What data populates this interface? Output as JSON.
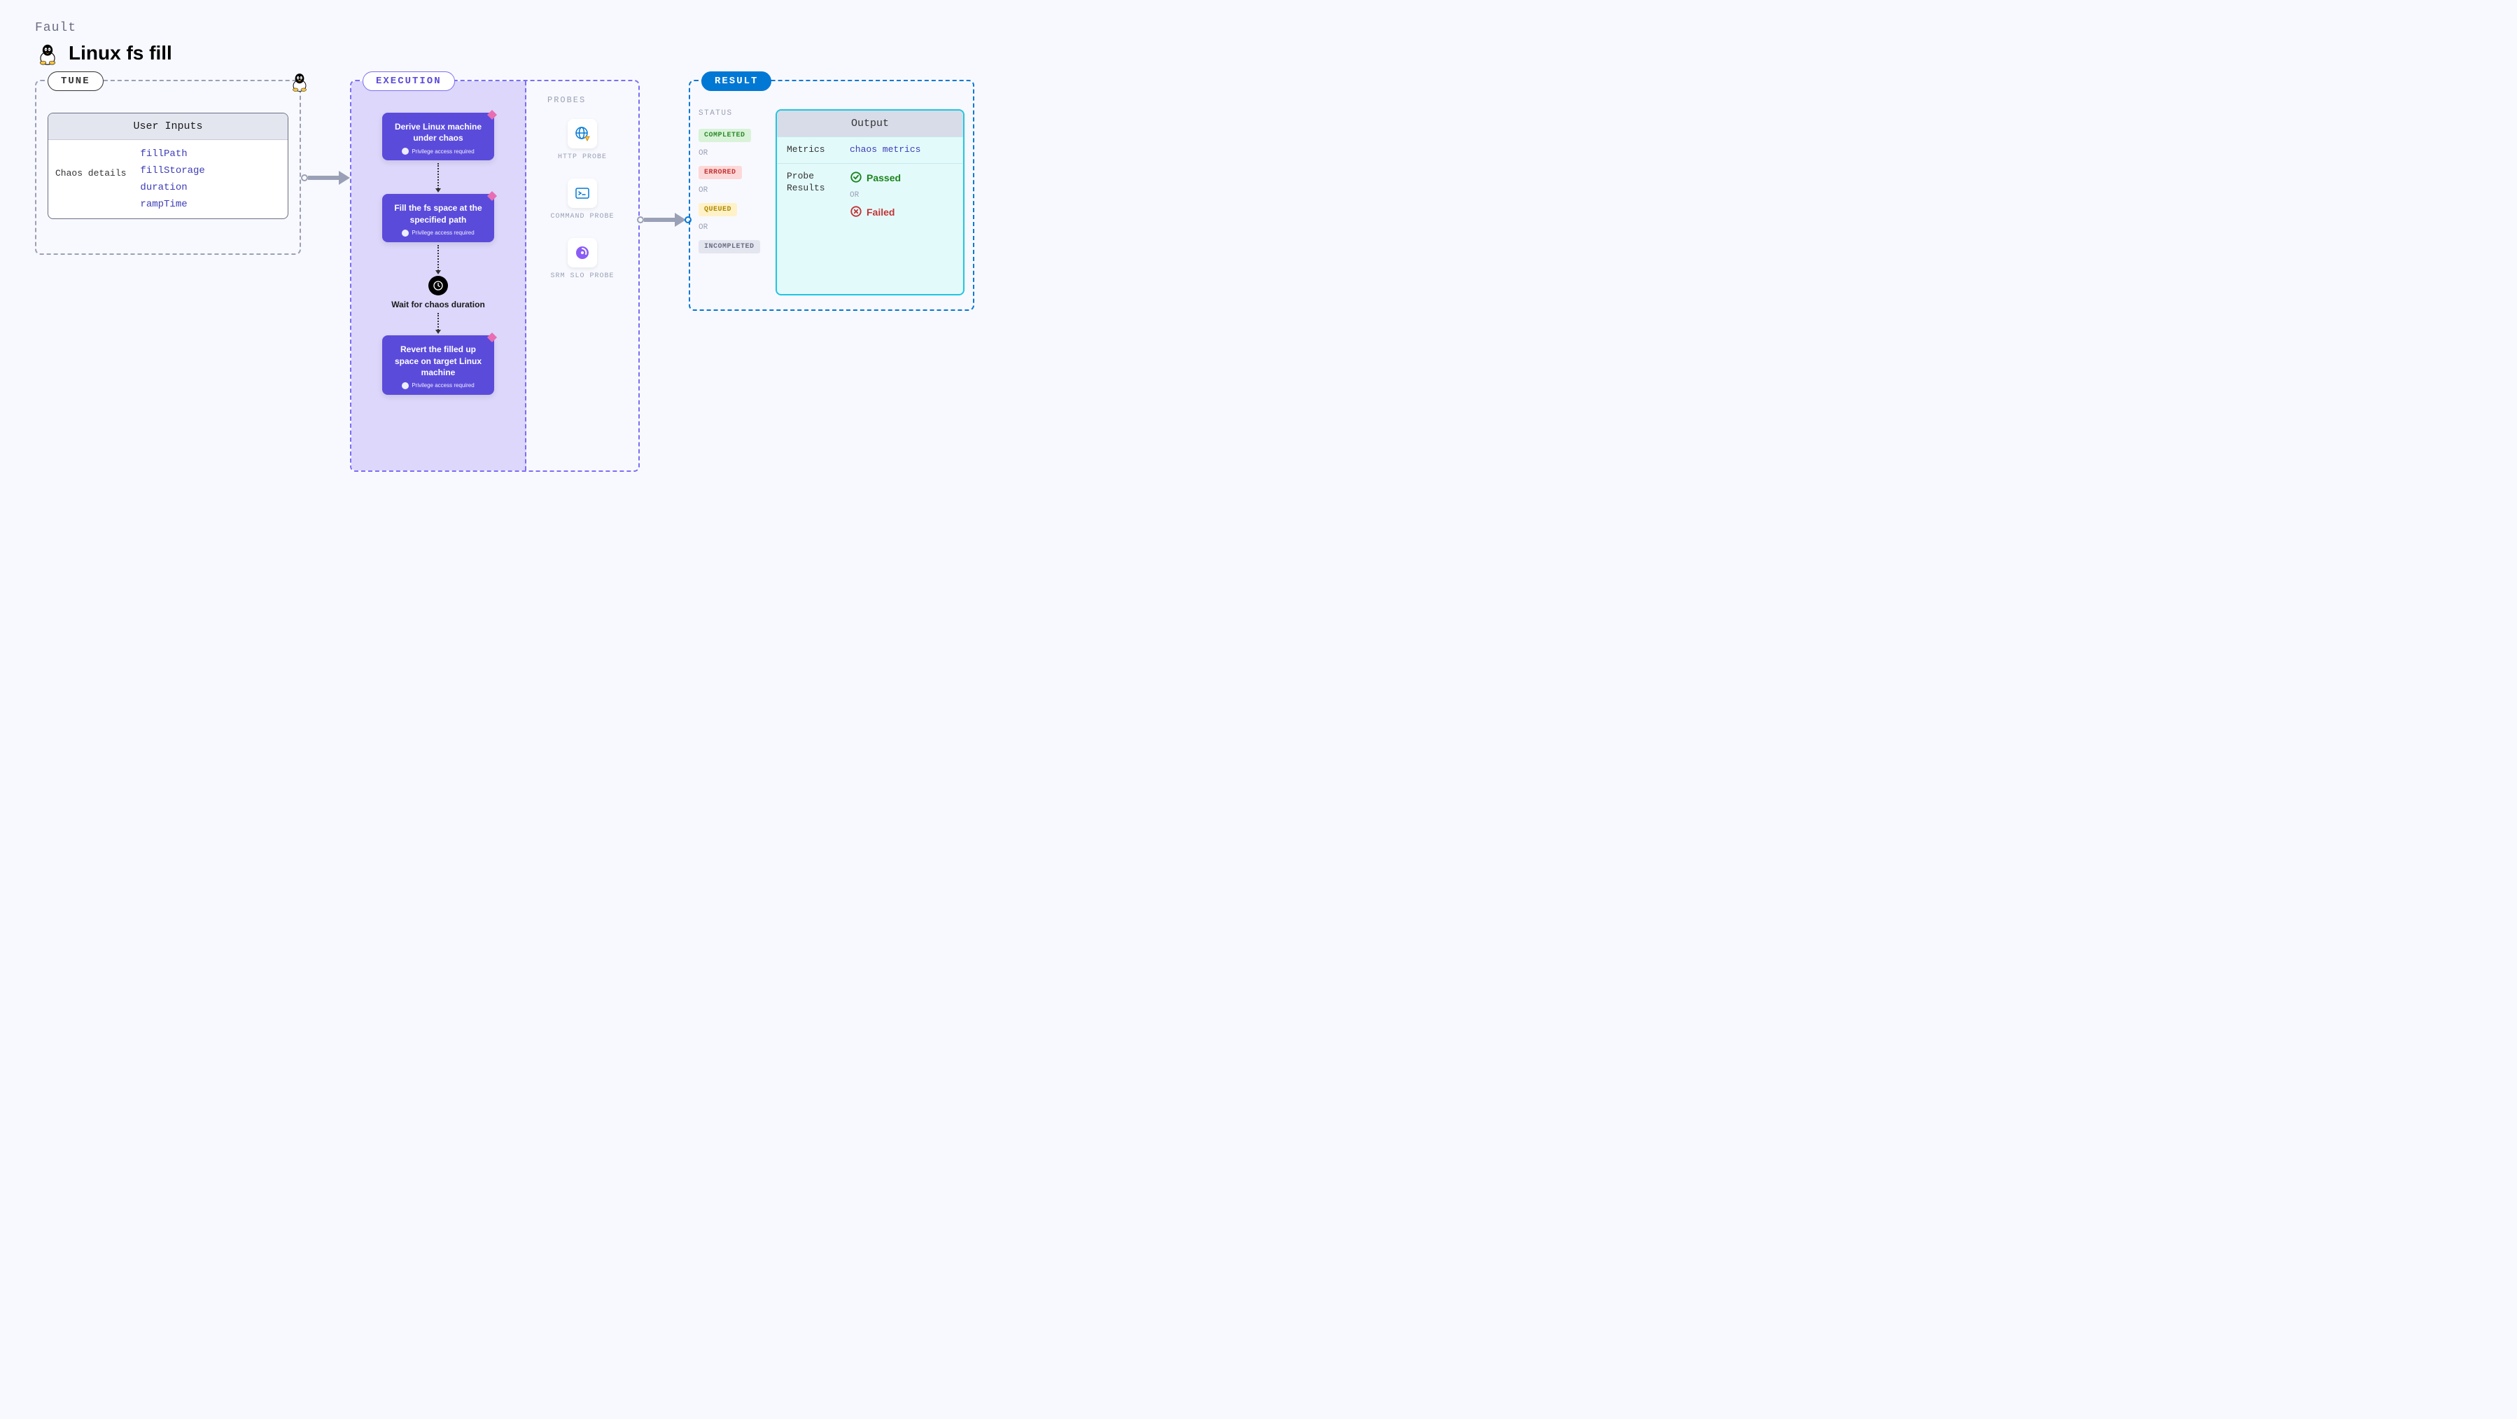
{
  "header": {
    "fault_label": "Fault",
    "title": "Linux fs fill"
  },
  "tune": {
    "label": "TUNE",
    "inputs_header": "User Inputs",
    "chaos_label": "Chaos details",
    "items": [
      "fillPath",
      "fillStorage",
      "duration",
      "rampTime"
    ]
  },
  "execution": {
    "label": "EXECUTION",
    "privilege_text": "Privilege access required",
    "steps": {
      "s1": "Derive Linux machine under chaos",
      "s2": "Fill the fs space at the specified path",
      "s3": "Revert the filled up space on target Linux machine"
    },
    "wait_text": "Wait for chaos duration",
    "probes_label": "PROBES",
    "probes": {
      "p1": "HTTP PROBE",
      "p2": "COMMAND PROBE",
      "p3": "SRM SLO PROBE"
    }
  },
  "result": {
    "label": "RESULT",
    "status_label": "STATUS",
    "or": "OR",
    "statuses": {
      "completed": "COMPLETED",
      "errored": "ERRORED",
      "queued": "QUEUED",
      "incompleted": "INCOMPLETED"
    },
    "output_header": "Output",
    "metrics_key": "Metrics",
    "metrics_val": "chaos metrics",
    "probe_key": "Probe Results",
    "passed": "Passed",
    "failed": "Failed"
  }
}
